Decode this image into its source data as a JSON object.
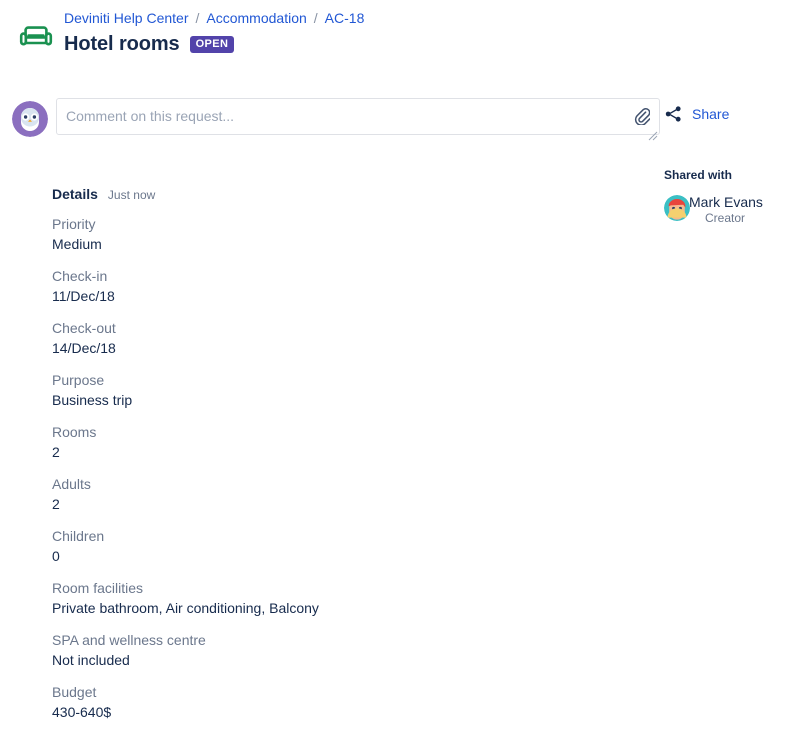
{
  "header": {
    "icon_name": "sofa-icon",
    "icon_color": "#1a9150",
    "breadcrumb": [
      {
        "label": "Deviniti Help Center",
        "type": "link"
      },
      {
        "label": "/",
        "type": "separator"
      },
      {
        "label": "Accommodation",
        "type": "link"
      },
      {
        "label": "/",
        "type": "separator"
      },
      {
        "label": "AC-18",
        "type": "link"
      }
    ],
    "title": "Hotel rooms",
    "status": "OPEN",
    "status_color": "#5243AA",
    "link_color": "#2157d4"
  },
  "comment": {
    "avatar_name": "owl-avatar",
    "placeholder": "Comment on this request...",
    "value": "",
    "attach_icon": "paperclip-icon"
  },
  "details": {
    "heading": "Details",
    "timestamp": "Just now",
    "fields": [
      {
        "label": "Priority",
        "value": "Medium"
      },
      {
        "label": "Check-in",
        "value": "11/Dec/18"
      },
      {
        "label": "Check-out",
        "value": "14/Dec/18"
      },
      {
        "label": "Purpose",
        "value": "Business trip"
      },
      {
        "label": "Rooms",
        "value": "2"
      },
      {
        "label": "Adults",
        "value": "2"
      },
      {
        "label": "Children",
        "value": "0"
      },
      {
        "label": "Room facilities",
        "value": "Private bathroom, Air conditioning, Balcony"
      },
      {
        "label": "SPA and wellness centre",
        "value": "Not included"
      },
      {
        "label": "Budget",
        "value": "430-640$"
      }
    ]
  },
  "sidebar": {
    "share_label": "Share",
    "share_icon": "share-icon",
    "shared_with_title": "Shared with",
    "people": [
      {
        "name": "Mark Evans",
        "role": "Creator",
        "avatar_name": "person-avatar"
      }
    ]
  }
}
